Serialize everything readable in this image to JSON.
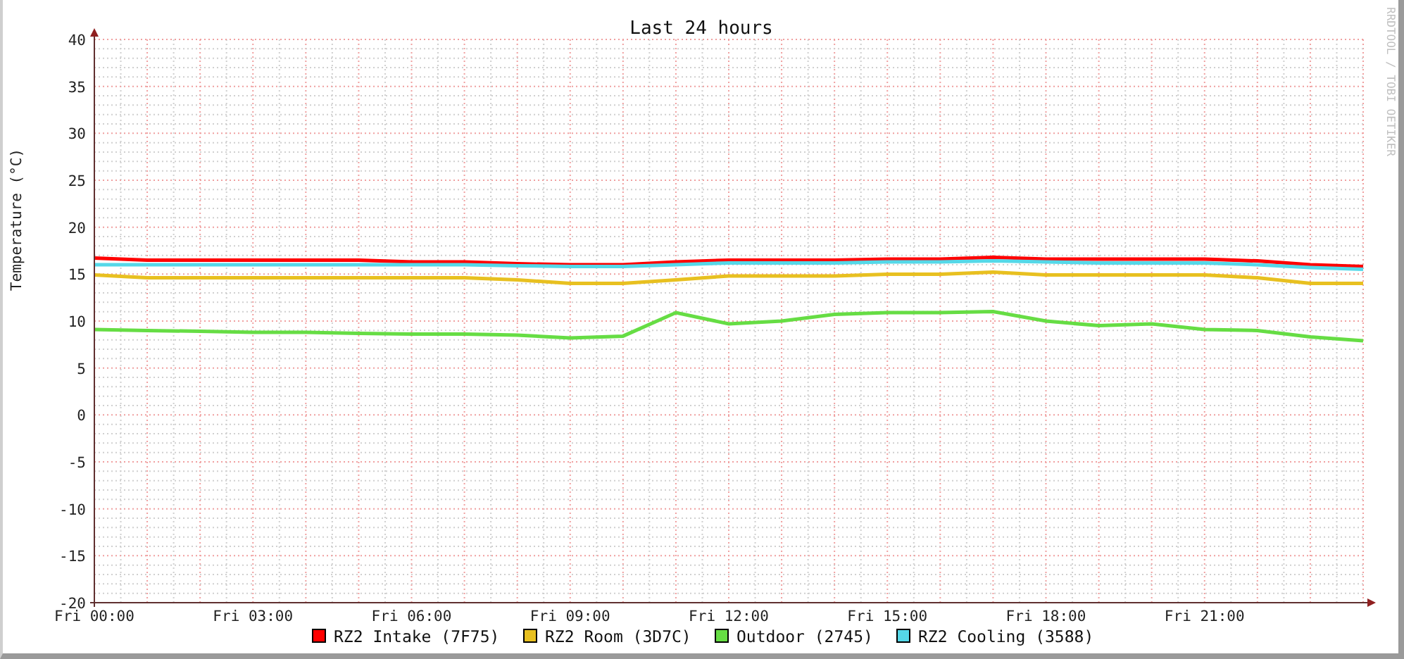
{
  "chart": {
    "watermark": "RRDTOOL / TOBI OETIKER",
    "chart_data": {
      "type": "line",
      "title": "Last 24 hours",
      "ylabel": "Temperature (°C)",
      "categories": [
        "Fri 00:00",
        null,
        null,
        "Fri 03:00",
        null,
        null,
        "Fri 06:00",
        null,
        null,
        "Fri 09:00",
        null,
        null,
        "Fri 12:00",
        null,
        null,
        "Fri 15:00",
        null,
        null,
        "Fri 18:00",
        null,
        null,
        "Fri 21:00",
        null,
        null,
        null
      ],
      "ylim": [
        -20,
        40
      ],
      "grid": true,
      "legend": "bottom",
      "yticks": [
        40,
        35,
        30,
        25,
        20,
        15,
        10,
        5,
        0,
        -5,
        -10,
        -15,
        -20
      ],
      "series": [
        {
          "name": "RZ2 Intake (7F75)",
          "color": "#ff0000",
          "values": [
            16.7,
            16.5,
            16.5,
            16.5,
            16.5,
            16.5,
            16.3,
            16.3,
            16.1,
            16.0,
            16.0,
            16.3,
            16.5,
            16.5,
            16.5,
            16.6,
            16.6,
            16.8,
            16.6,
            16.6,
            16.6,
            16.6,
            16.4,
            16.0,
            15.8
          ]
        },
        {
          "name": "RZ2 Room (3D7C)",
          "color": "#e8c020",
          "values": [
            14.9,
            14.6,
            14.6,
            14.6,
            14.6,
            14.6,
            14.6,
            14.6,
            14.4,
            14.0,
            14.0,
            14.4,
            14.8,
            14.8,
            14.8,
            15.0,
            15.0,
            15.2,
            14.9,
            14.9,
            14.9,
            14.9,
            14.6,
            14.0,
            14.0
          ]
        },
        {
          "name": "Outdoor (2745)",
          "color": "#66dd44",
          "values": [
            9.1,
            9.0,
            8.9,
            8.8,
            8.8,
            8.7,
            8.6,
            8.6,
            8.5,
            8.2,
            8.4,
            10.9,
            9.7,
            10.0,
            10.7,
            10.9,
            10.9,
            11.0,
            10.0,
            9.5,
            9.7,
            9.1,
            9.0,
            8.3,
            7.9
          ]
        },
        {
          "name": "RZ2 Cooling (3588)",
          "color": "#55d8e8",
          "values": [
            16.0,
            16.0,
            16.0,
            16.0,
            16.0,
            16.0,
            16.0,
            16.0,
            15.9,
            15.8,
            15.8,
            16.0,
            16.2,
            16.2,
            16.2,
            16.3,
            16.3,
            16.4,
            16.3,
            16.2,
            16.2,
            16.2,
            16.0,
            15.7,
            15.5
          ]
        }
      ]
    }
  }
}
